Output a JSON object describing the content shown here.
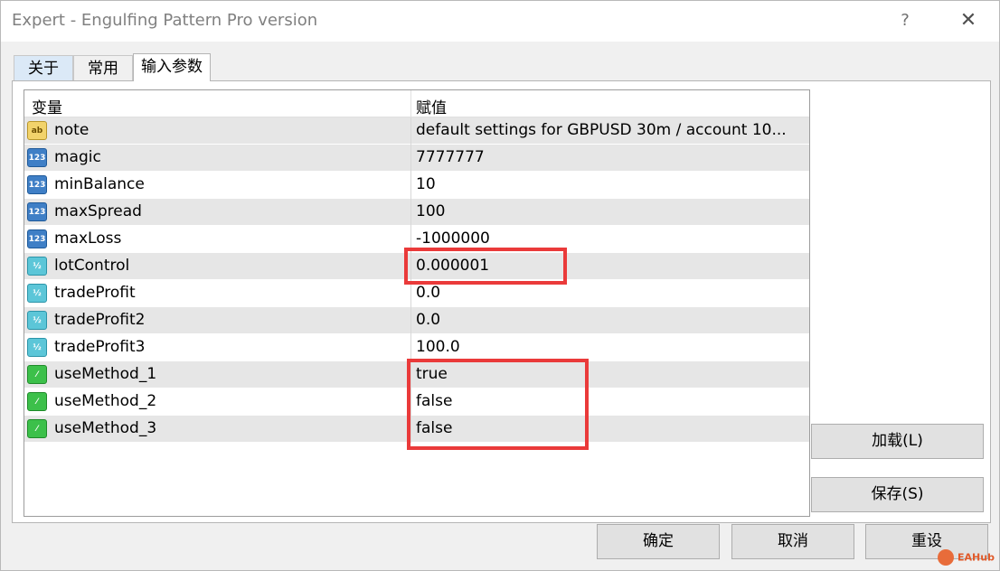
{
  "window": {
    "title": "Expert - Engulfing Pattern Pro version",
    "help_label": "?",
    "close_label": "✕"
  },
  "tabs": [
    {
      "label": "关于"
    },
    {
      "label": "常用"
    },
    {
      "label": "输入参数",
      "active": true
    }
  ],
  "grid": {
    "columns": [
      "变量",
      "赋值"
    ],
    "rows": [
      {
        "icon": "string-icon",
        "type_glyph": "ab",
        "name": "note",
        "value": "default settings for GBPUSD 30m / account 10..."
      },
      {
        "icon": "integer-icon",
        "type_glyph": "123",
        "name": "magic",
        "value": "7777777"
      },
      {
        "icon": "integer-icon",
        "type_glyph": "123",
        "name": "minBalance",
        "value": "10"
      },
      {
        "icon": "integer-icon",
        "type_glyph": "123",
        "name": "maxSpread",
        "value": "100"
      },
      {
        "icon": "integer-icon",
        "type_glyph": "123",
        "name": "maxLoss",
        "value": "-1000000"
      },
      {
        "icon": "double-icon",
        "type_glyph": "½",
        "name": "lotControl",
        "value": "0.000001"
      },
      {
        "icon": "double-icon",
        "type_glyph": "½",
        "name": "tradeProfit",
        "value": "0.0"
      },
      {
        "icon": "double-icon",
        "type_glyph": "½",
        "name": "tradeProfit2",
        "value": "0.0"
      },
      {
        "icon": "double-icon",
        "type_glyph": "½",
        "name": "tradeProfit3",
        "value": "100.0"
      },
      {
        "icon": "bool-icon",
        "type_glyph": "⁄",
        "name": "useMethod_1",
        "value": "true"
      },
      {
        "icon": "bool-icon",
        "type_glyph": "⁄",
        "name": "useMethod_2",
        "value": "false"
      },
      {
        "icon": "bool-icon",
        "type_glyph": "⁄",
        "name": "useMethod_3",
        "value": "false"
      }
    ]
  },
  "buttons": {
    "load": "加载(L)",
    "save": "保存(S)",
    "ok": "确定",
    "cancel": "取消",
    "reset": "重设"
  },
  "watermark": "EAHub",
  "colors": {
    "highlight": "#ea3a3a",
    "active_tab": "#ffffff",
    "row_alt": "#e6e6e6"
  }
}
